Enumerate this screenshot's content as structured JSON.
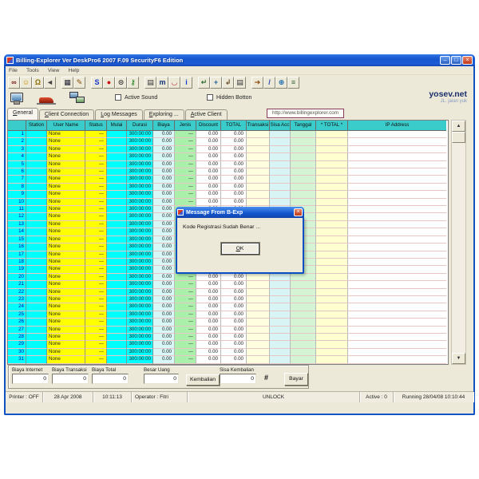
{
  "window": {
    "title": "Billing-Explorer Ver DeskPro6 2007 F.09 SecurityF6 Edition",
    "menu_items": [
      "File",
      "Tools",
      "View",
      "Help"
    ]
  },
  "icons": {
    "minimize": "–",
    "maximize": "□",
    "close": "×",
    "scroll_up": "▲",
    "scroll_down": "▼"
  },
  "toolbar": {
    "groups": [
      [
        {
          "name": "find-icon",
          "glyph": "∞",
          "color": "#7a1515"
        },
        {
          "name": "smiley-icon",
          "glyph": "☺",
          "color": "#c79100"
        },
        {
          "name": "lock-icon",
          "glyph": "Ω",
          "color": "#8a6d00"
        },
        {
          "name": "mute-icon",
          "glyph": "◄",
          "color": "#444444"
        }
      ],
      [
        {
          "name": "printer-dark-icon",
          "glyph": "▦",
          "color": "#222233"
        },
        {
          "name": "pen-icon",
          "glyph": "✎",
          "color": "#8a4a00"
        }
      ],
      [
        {
          "name": "server-icon",
          "glyph": "S",
          "color": "#1133cc"
        },
        {
          "name": "stop-icon",
          "glyph": "●",
          "color": "#cc1111"
        },
        {
          "name": "timer-icon",
          "glyph": "⊙",
          "color": "#333333"
        },
        {
          "name": "key-icon",
          "glyph": "⚷",
          "color": "#117711"
        }
      ],
      [
        {
          "name": "print-icon",
          "glyph": "▤",
          "color": "#333333"
        },
        {
          "name": "users-icon",
          "glyph": "m",
          "color": "#113377"
        },
        {
          "name": "chat-icon",
          "glyph": "◡",
          "color": "#bb2222"
        },
        {
          "name": "info-icon",
          "glyph": "i",
          "color": "#1144cc"
        }
      ],
      [
        {
          "name": "undo-icon",
          "glyph": "↵",
          "color": "#226622"
        },
        {
          "name": "move-icon",
          "glyph": "+",
          "color": "#226699"
        },
        {
          "name": "redo-icon",
          "glyph": "↲",
          "color": "#664422"
        },
        {
          "name": "print2-icon",
          "glyph": "▤",
          "color": "#333333"
        }
      ],
      [
        {
          "name": "exit-icon",
          "glyph": "➔",
          "color": "#884400"
        },
        {
          "name": "edit-icon",
          "glyph": "/",
          "color": "#2244aa"
        },
        {
          "name": "globe-icon",
          "glyph": "⊕",
          "color": "#1166aa"
        },
        {
          "name": "page-icon",
          "glyph": "≡",
          "color": "#336633"
        }
      ]
    ]
  },
  "checkboxes": {
    "sound_label": "Active Sound",
    "hidden_label": "Hidden Botton"
  },
  "brand": {
    "name": "yosev.net",
    "subtitle": "JL. jalan yuk"
  },
  "tabs": [
    "General",
    "Client Connection",
    "Log Messages",
    "Exploring ...",
    "Active Client"
  ],
  "url": "http://www.billingexplorer.com",
  "table": {
    "headers": [
      "",
      "Station",
      "User Name",
      "Status",
      "Mulai",
      "Durasi",
      "Biaya",
      "Jenis",
      "Discount",
      "TOTAL",
      "Transaksi",
      "Sisa Acc",
      "Tanggal",
      "* TOTAL *",
      "IP Address"
    ],
    "row_count": 31,
    "row": {
      "station": "",
      "user_name": "None",
      "status": "---",
      "mulai": "",
      "durasi": "300:00:00",
      "biaya": "0.00",
      "jenis": "---",
      "discount": "0.00",
      "total": "0.00",
      "transaksi": "",
      "sisa_acc": "",
      "tanggal": "",
      "total2": "",
      "ip": ""
    }
  },
  "dialog": {
    "title": "Message From B-Exp",
    "message": "Kode Registrasi Sudah Benar ...",
    "ok_label": "OK"
  },
  "payment": {
    "fields": [
      {
        "label": "Biaya Internet",
        "value": "0"
      },
      {
        "label": "Biaya Transaksi",
        "value": "0"
      },
      {
        "label": "Biaya Total",
        "value": "0"
      },
      {
        "label": "Besar Uang",
        "value": "0"
      },
      {
        "label": "Sisa Kembalian",
        "value": "0"
      }
    ],
    "kembalian_label": "Kembalian",
    "bayar_label": "Bayar",
    "hash_symbol": "#"
  },
  "statusbar": [
    "Printer : OFF",
    "28 Apr 2008",
    "10:11:13",
    "Operator : Fitri",
    "UNLOCK",
    "Active :  0",
    "Running 28/04/08  10:10:44"
  ],
  "colors": {
    "titlebar_blue": "#1557cd",
    "window_bg": "#ece9d8",
    "header_cyan": "#3acbcb",
    "cell_cyan": "#00ffff",
    "cell_yellow": "#ffff00",
    "cell_pale_cyan": "#d8f8f8",
    "cell_pale_green": "#aaefaa",
    "cell_pale_yellow": "#ffffdf",
    "close_red": "#c03a1a",
    "brand_navy": "#1a2f6e",
    "url_border_maroon": "#8a3a5a"
  }
}
